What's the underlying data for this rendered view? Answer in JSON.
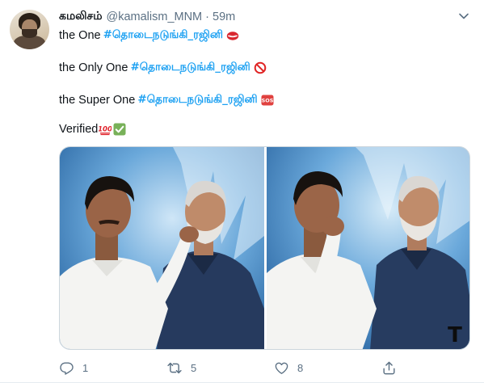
{
  "tweet": {
    "author_name": "கமலிசம்",
    "author_handle": "@kamalism_MNM",
    "separator": "·",
    "timestamp": "59m",
    "lines": [
      {
        "prefix": "the One",
        "hashtag": "#தொடைநடுங்கி_ரஜினி",
        "emoji_icon": "lips-icon"
      },
      {
        "prefix": "the Only One",
        "hashtag": "#தொடைநடுங்கி_ரஜினி",
        "emoji_icon": "prohibited-icon"
      },
      {
        "prefix": "the Super One",
        "hashtag": "#தொடைநடுங்கி_ரஜினி",
        "emoji_icon": "sos-icon",
        "emoji_text": "SOS"
      },
      {
        "prefix": "Verified",
        "emoji_icon": "hundred-points-icon",
        "emoji_text": "100",
        "emoji2_icon": "check-mark-icon"
      }
    ],
    "media_corner_mark": "T",
    "actions": {
      "reply_count": "1",
      "retweet_count": "5",
      "like_count": "8"
    }
  },
  "colors": {
    "hashtag": "#1da1f2",
    "secondary_text": "#5b7083",
    "border": "#ccd6dd",
    "media_background": "#1f5f9e"
  }
}
